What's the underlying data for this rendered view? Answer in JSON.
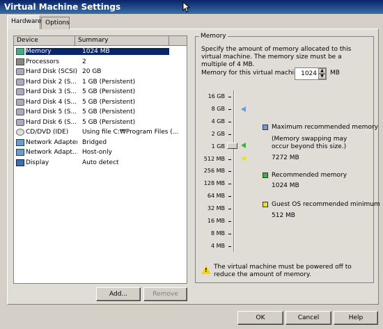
{
  "window": {
    "title": "Virtual Machine Settings"
  },
  "tabs": [
    {
      "label": "Hardware"
    },
    {
      "label": "Options"
    }
  ],
  "device_list": {
    "columns": [
      "Device",
      "Summary"
    ],
    "rows": [
      {
        "device": "Memory",
        "summary": "1024 MB",
        "icon": "memory-icon"
      },
      {
        "device": "Processors",
        "summary": "2",
        "icon": "processor-icon"
      },
      {
        "device": "Hard Disk (SCSI)",
        "summary": "20 GB",
        "icon": "hard-disk-icon"
      },
      {
        "device": "Hard Disk 2 (S...",
        "summary": "1 GB (Persistent)",
        "icon": "hard-disk-icon"
      },
      {
        "device": "Hard Disk 3 (S...",
        "summary": "5 GB (Persistent)",
        "icon": "hard-disk-icon"
      },
      {
        "device": "Hard Disk 4 (S...",
        "summary": "5 GB (Persistent)",
        "icon": "hard-disk-icon"
      },
      {
        "device": "Hard Disk 5 (S...",
        "summary": "5 GB (Persistent)",
        "icon": "hard-disk-icon"
      },
      {
        "device": "Hard Disk 6 (S...",
        "summary": "5 GB (Persistent)",
        "icon": "hard-disk-icon"
      },
      {
        "device": "CD/DVD (IDE)",
        "summary": "Using file C:₩Program Files (...",
        "icon": "cd-dvd-icon"
      },
      {
        "device": "Network Adapter",
        "summary": "Bridged",
        "icon": "network-adapter-icon"
      },
      {
        "device": "Network Adapt...",
        "summary": "Host-only",
        "icon": "network-adapter-icon"
      },
      {
        "device": "Display",
        "summary": "Auto detect",
        "icon": "display-icon"
      }
    ]
  },
  "list_buttons": {
    "add": "Add...",
    "remove": "Remove"
  },
  "memory": {
    "legend": "Memory",
    "description": "Specify the amount of memory allocated to this virtual machine. The memory size must be a multiple of 4 MB.",
    "field_label": "Memory for this virtual machine:",
    "value": "1024",
    "unit": "MB",
    "scale": [
      "16 GB",
      "8 GB",
      "4 GB",
      "2 GB",
      "1 GB",
      "512 MB",
      "256 MB",
      "128 MB",
      "64 MB",
      "32 MB",
      "16 MB",
      "8 MB",
      "4 MB"
    ],
    "max_recommended": {
      "label": "Maximum recommended memory",
      "note": "(Memory swapping may occur beyond this size.)",
      "value": "7272 MB",
      "color": "#6e9ad8"
    },
    "recommended": {
      "label": "Recommended memory",
      "value": "1024 MB",
      "color": "#3cb040"
    },
    "guest_min": {
      "label": "Guest OS recommended minimum",
      "value": "512 MB",
      "color": "#e8e030"
    },
    "warning": "The virtual machine must be powered off to reduce the amount of memory."
  },
  "footer": {
    "ok": "OK",
    "cancel": "Cancel",
    "help": "Help"
  }
}
